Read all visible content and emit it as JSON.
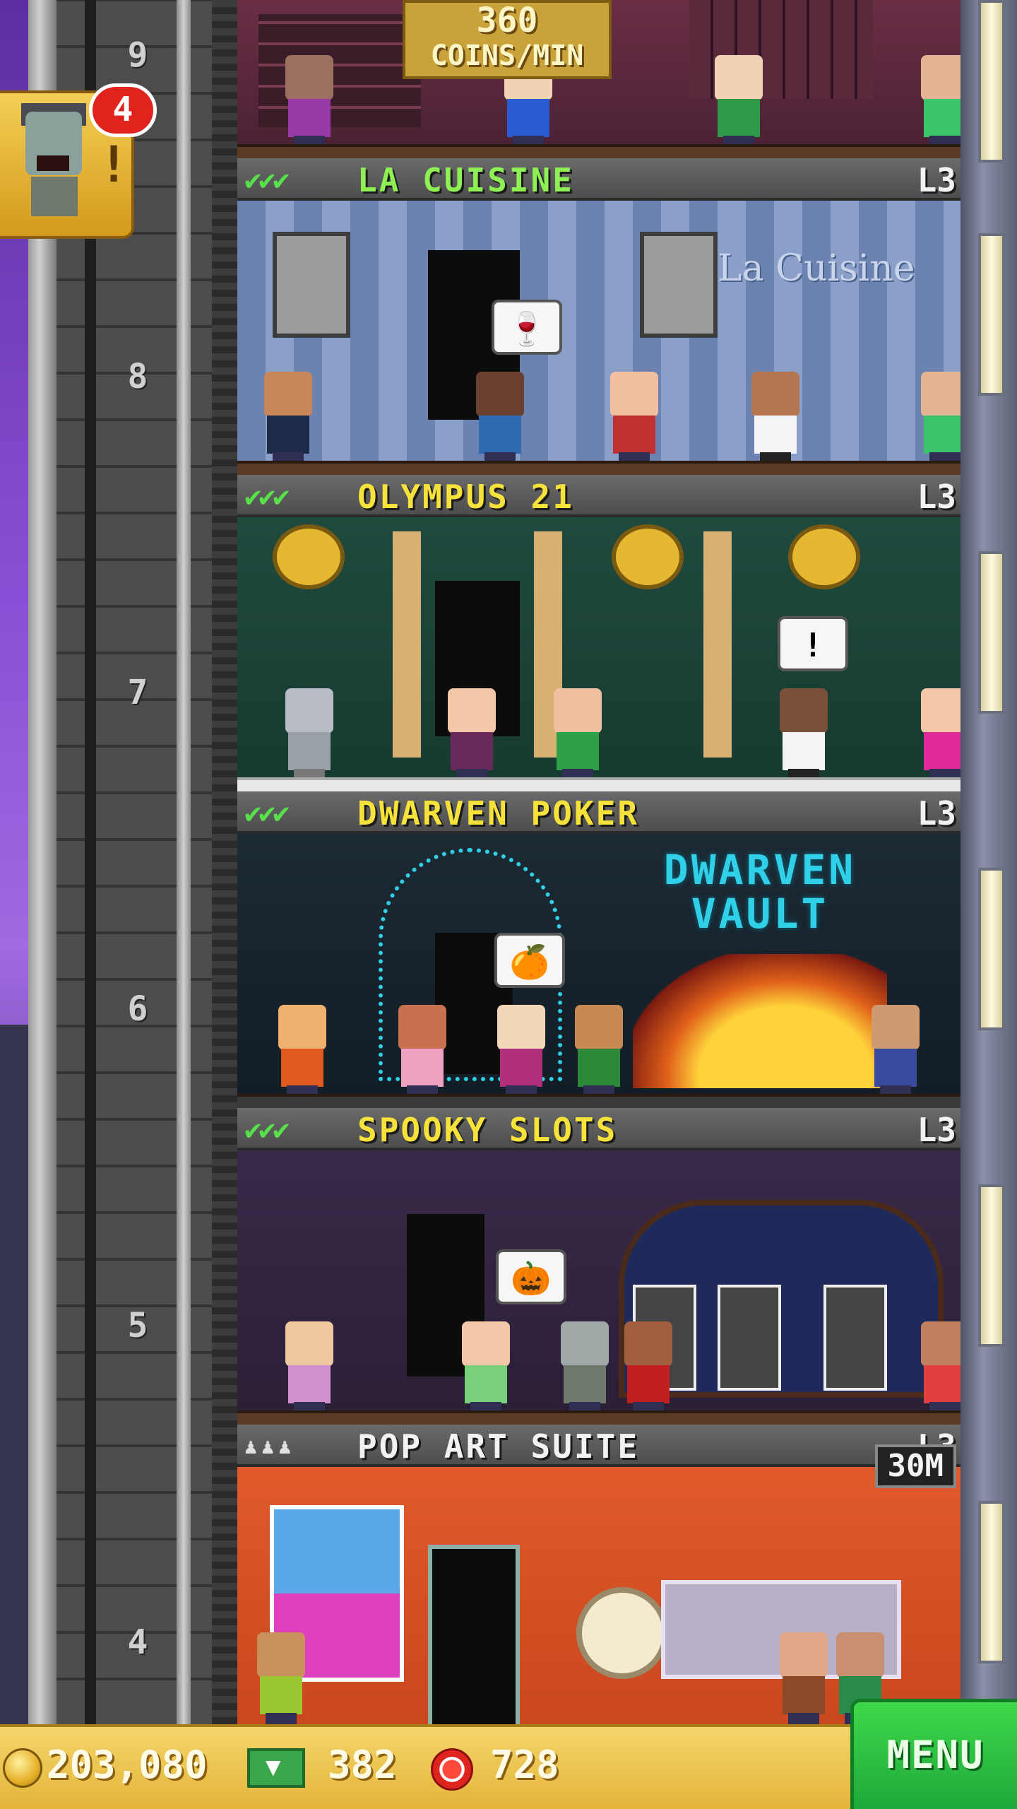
{
  "hud": {
    "coins": "203,080",
    "bux": "382",
    "chips": "728",
    "menu_label": "MENU"
  },
  "notification": {
    "count": "4",
    "mark": "!"
  },
  "top_floor": {
    "coins_rate": "360",
    "coins_unit": "COINS/MIN",
    "level_num": "9"
  },
  "floors": [
    {
      "number": "8",
      "name": "LA CUISINE",
      "level": "L3",
      "stars": "✔✔✔",
      "sign": "La Cuisine",
      "bubble": "🍷",
      "name_color": "#8ef054"
    },
    {
      "number": "7",
      "name": "OLYMPUS 21",
      "level": "L3",
      "stars": "✔✔✔",
      "bubble": "!",
      "name_color": "#f6e23a"
    },
    {
      "number": "6",
      "name": "DWARVEN POKER",
      "level": "L3",
      "stars": "✔✔✔",
      "sign_line1": "DWARVEN",
      "sign_line2": "VAULT",
      "bubble": "🍊",
      "name_color": "#f6e23a"
    },
    {
      "number": "5",
      "name": "SPOOKY SLOTS",
      "level": "L3",
      "stars": "✔✔✔",
      "bubble": "🎃",
      "name_color": "#f6e23a"
    },
    {
      "number": "4",
      "name": "POP ART SUITE",
      "level": "L3",
      "stars": "♟♟♟",
      "price": "30M",
      "name_color": "#f2f2f2"
    }
  ]
}
